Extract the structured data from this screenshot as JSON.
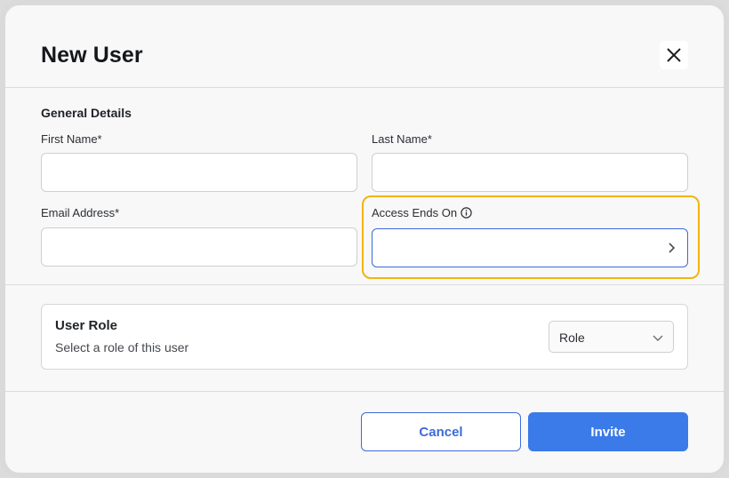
{
  "dialog": {
    "title": "New User",
    "close_icon": "close-icon"
  },
  "general": {
    "section_title": "General Details",
    "first_name": {
      "label": "First Name*",
      "value": ""
    },
    "last_name": {
      "label": "Last Name*",
      "value": ""
    },
    "email": {
      "label": "Email Address*",
      "value": ""
    },
    "access_ends": {
      "label": "Access Ends On",
      "value": "",
      "icon": "info-icon",
      "chevron_icon": "chevron-right-icon"
    }
  },
  "role": {
    "title": "User Role",
    "description": "Select a role of this user",
    "select_value": "Role",
    "chevron_icon": "chevron-down-icon"
  },
  "footer": {
    "cancel_label": "Cancel",
    "invite_label": "Invite"
  },
  "colors": {
    "accent": "#3b7ae9",
    "highlight": "#f2b411",
    "background": "#f8f8f8"
  }
}
